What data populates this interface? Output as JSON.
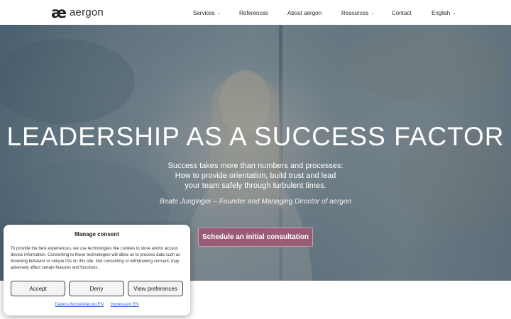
{
  "header": {
    "logo_mark": "æ",
    "logo_text": "aergon",
    "nav": [
      {
        "label": "Services",
        "has_dropdown": true
      },
      {
        "label": "References",
        "has_dropdown": false
      },
      {
        "label": "About aergon",
        "has_dropdown": false
      },
      {
        "label": "Resources",
        "has_dropdown": true
      },
      {
        "label": "Contact",
        "has_dropdown": false
      },
      {
        "label": "English",
        "has_dropdown": true
      }
    ],
    "chevron": "⌄"
  },
  "hero": {
    "title": "LEADERSHIP AS A SUCCESS FACTOR",
    "subtitle_lines": [
      "Success takes more than numbers and processes:",
      "How to provide orientation, build trust and lead",
      "your team safely through turbulent times."
    ],
    "quote": "Beate Junginger – Founder and Managing Director of aergon",
    "cta_label": "Schedule an initial consultation",
    "cta_color": "#9a5b76"
  },
  "consent": {
    "title": "Manage consent",
    "text": "To provide the best experiences, we use technologies like cookies to store and/or access device information. Consenting to these technologies will allow us to process data such as browsing behavior or unique IDs on this site. Not consenting or withdrawing consent, may adversely affect certain features and functions.",
    "accept_label": "Accept",
    "deny_label": "Deny",
    "preferences_label": "View preferences",
    "links": [
      "Datenschutzerklärung EN",
      "Impressum EN"
    ]
  }
}
